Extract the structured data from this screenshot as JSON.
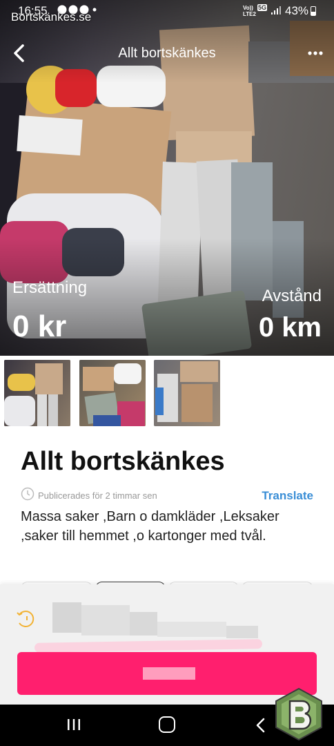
{
  "status_bar": {
    "time": "16:55",
    "icons": [
      "messenger-icon",
      "facebook-icon",
      "messenger-icon",
      "dot"
    ],
    "network_top": "Vo))",
    "network_bottom": "LTE2",
    "signal_badge": "5G",
    "battery": "43%"
  },
  "watermark": "Bortskänkes.se",
  "header": {
    "title": "Allt bortskänkes",
    "back_icon": "chevron-left-icon",
    "more_icon": "more-dots-icon"
  },
  "hero": {
    "price_label": "Ersättning",
    "price_value": "0 kr",
    "distance_label": "Avstånd",
    "distance_value": "0 km"
  },
  "listing": {
    "title": "Allt bortskänkes",
    "published": "Publicerades för  2 timmar sen",
    "translate_label": "Translate",
    "description": "Massa saker ,Barn o damkläder ,Leksaker ,saker till hemmet ,o kartonger med tvål."
  },
  "colors": {
    "cta": "#ff1f6e",
    "translate_link": "#3a8ed6",
    "sheet_bg": "#f1f1f1"
  },
  "android_nav": {
    "recents_icon": "recents-icon",
    "home_icon": "home-icon",
    "back_icon": "back-icon"
  }
}
